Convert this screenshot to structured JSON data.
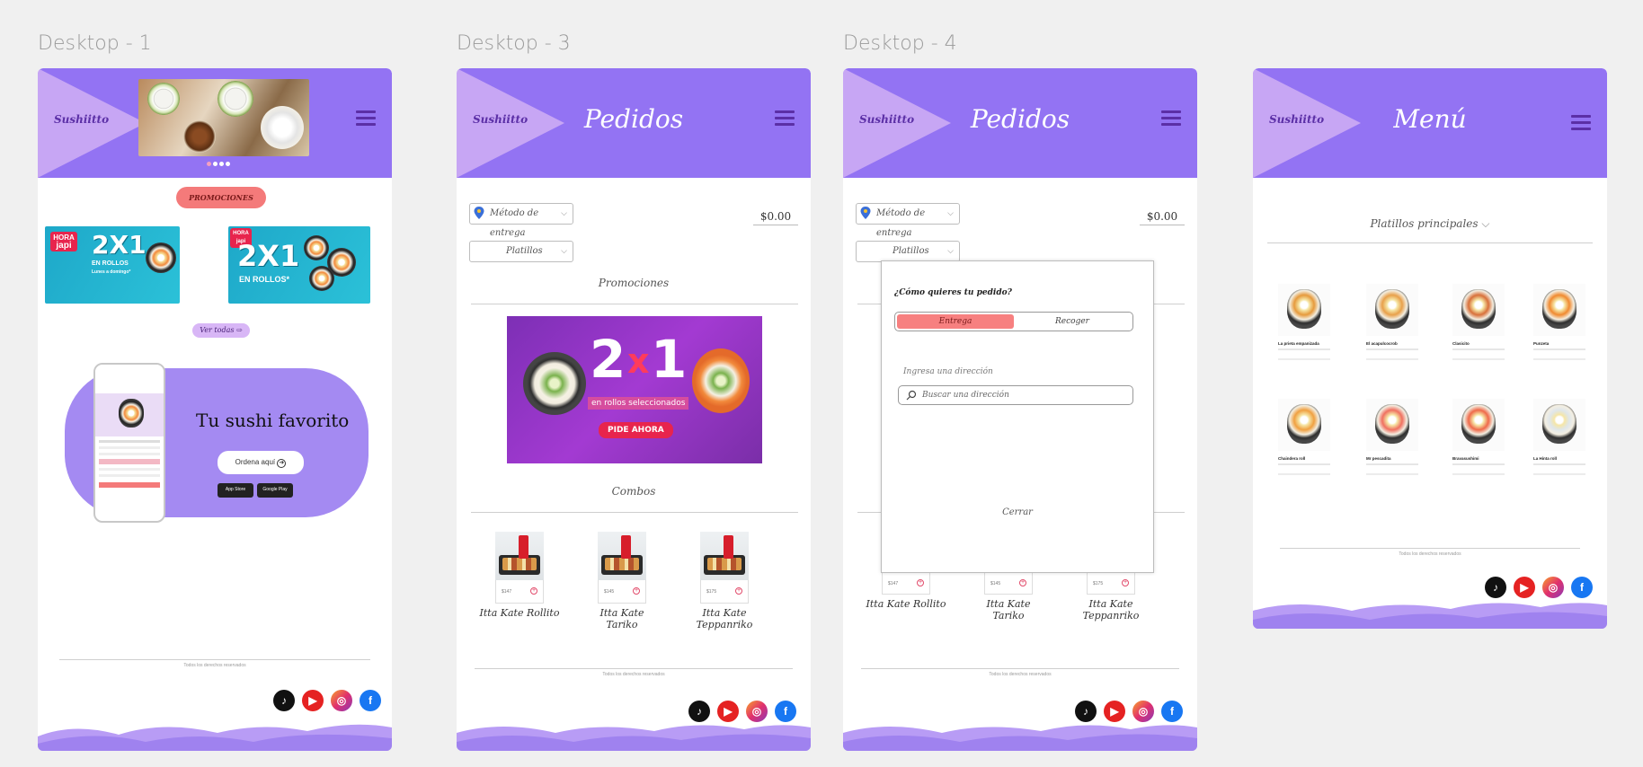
{
  "frames": {
    "f1": {
      "label": "Desktop - 1",
      "logo": "Sushiitto",
      "promotions_btn": "PROMOCIONES",
      "see_all_btn": "Ver todas",
      "banner1": {
        "tag1": "HORA",
        "tag2": "japi",
        "big": "2X1",
        "sub1": "EN ROLLOS",
        "sub2": "Lunes a domingo*"
      },
      "banner2": {
        "tag1": "HORA",
        "tag2": "japi",
        "big": "2X1",
        "sub1": "EN ROLLOS*"
      },
      "fav_title": "Tu sushi  favorito",
      "order_btn": "Ordena aquí",
      "app_store": "App Store",
      "google_play": "Google Play",
      "copyright": "Todos los derechos reservados"
    },
    "f3": {
      "label": "Desktop - 3",
      "logo": "Sushiitto",
      "title": "Pedidos",
      "delivery_select": "Método de entrega",
      "price": "$0.00",
      "category_select": "Platillos",
      "promos_title": "Promociones",
      "promo": {
        "big1": "2",
        "x": "x",
        "big2": "1",
        "sub": "en rollos seleccionados",
        "cta": "PIDE AHORA"
      },
      "combos_title": "Combos",
      "combos": [
        {
          "name": "Itta Kate Rollito",
          "price": "$147"
        },
        {
          "name": "Itta Kate Tariko",
          "price": "$145"
        },
        {
          "name": "Itta Kate Teppanriko",
          "price": "$175"
        }
      ],
      "copyright": "Todos los derechos reservados"
    },
    "f4": {
      "label": "Desktop - 4",
      "logo": "Sushiitto",
      "title": "Pedidos",
      "delivery_select": "Método de entrega",
      "price": "$0.00",
      "category_select": "Platillos",
      "modal": {
        "question": "¿Cómo quieres tu pedido?",
        "option_delivery": "Entrega",
        "option_pickup": "Recoger",
        "address_label": "Ingresa una dirección",
        "search_placeholder": "Buscar una dirección",
        "close": "Cerrar"
      },
      "combos": [
        {
          "name": "Itta Kate Rollito",
          "price": "$147"
        },
        {
          "name": "Itta Kate Tariko",
          "price": "$145"
        },
        {
          "name": "Itta Kate Teppanriko",
          "price": "$175"
        }
      ],
      "copyright": "Todos los derechos reservados"
    },
    "f5": {
      "logo": "Sushiitto",
      "title": "Menú",
      "category": "Platillos principales",
      "dishes": [
        {
          "name": "La prieta empanizada",
          "color": "#e69a3c"
        },
        {
          "name": "El acapulcocrob",
          "color": "#e8a04a"
        },
        {
          "name": "Clasicito",
          "color": "#d8703a"
        },
        {
          "name": "Punzeta",
          "color": "#f08a30"
        },
        {
          "name": "Chaindera roll",
          "color": "#f0a040"
        },
        {
          "name": "Mr pescadita",
          "color": "#f07060"
        },
        {
          "name": "Bravasushimi",
          "color": "#ef6a4a"
        },
        {
          "name": "La Hinta roll",
          "color": "#dfe6ea"
        }
      ],
      "copyright": "Todos los derechos reservados"
    }
  }
}
